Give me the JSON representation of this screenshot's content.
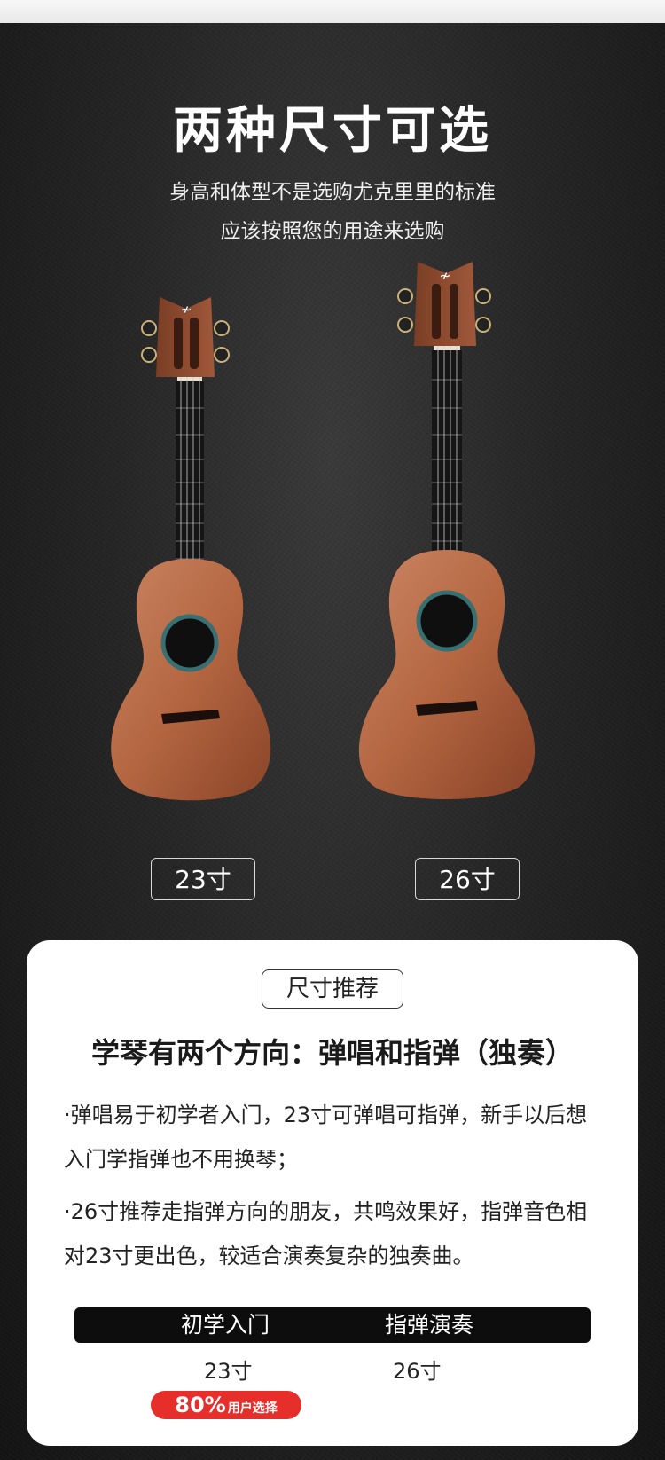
{
  "hero": {
    "title": "两种尺寸可选",
    "subtitle_line1": "身高和体型不是选购尤克里里的标准",
    "subtitle_line2": "应该按照您的用途来选购"
  },
  "sizes": [
    {
      "label": "23寸"
    },
    {
      "label": "26寸"
    }
  ],
  "recommendation": {
    "badge": "尺寸推荐",
    "heading": "学琴有两个方向：弹唱和指弹（独奏）",
    "point1": "·弹唱易于初学者入门，23寸可弹唱可指弹，新手以后想入门学指弹也不用换琴；",
    "point2": "·26寸推荐走指弹方向的朋友，共鸣效果好，指弹音色相对23寸更出色，较适合演奏复杂的独奏曲。",
    "table": {
      "headers": [
        "初学入门",
        "指弹演奏"
      ],
      "values": [
        "23寸",
        "26寸"
      ]
    },
    "badge_percent": "80%",
    "badge_label": "用户选择"
  },
  "colors": {
    "wood": "#b86a45",
    "fretboard": "#151515",
    "accent_red": "#e62e2b"
  },
  "icons": [
    "ukulele-23-image",
    "ukulele-26-image",
    "brand-logo-icon"
  ]
}
